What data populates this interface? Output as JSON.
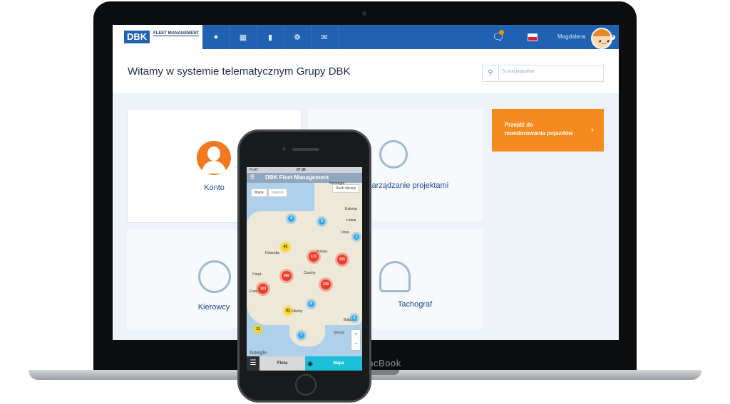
{
  "app": {
    "logo_text": "DBK",
    "logo_sub": "FLEET MANAGEMENT",
    "user_name": "Magdalena",
    "page_title": "Witamy w systemie telematycznym Grupy DBK",
    "search_placeholder": "Szukaj pojazdów",
    "nav_icons": [
      "globe-icon",
      "calendar-icon",
      "chart-icon",
      "gear-icon",
      "mail-icon"
    ],
    "accent_color": "#2061b1",
    "cta_color": "#f58b1f"
  },
  "tiles": {
    "konto": "Konto",
    "projects": "Zarządzanie projektami",
    "drivers": "Kierowcy",
    "tachograph": "Tachograf"
  },
  "cta": {
    "line1": "Przejdź do",
    "line2": "monitorowania pojazdów"
  },
  "laptop_brand": "MacBook",
  "phone": {
    "carrier": "PLAY",
    "time": "07:36",
    "title": "DBK Fleet Management",
    "map_toggle": [
      "Mapa",
      "Satelita"
    ],
    "traffic_button": "Ruch uliczny",
    "countries": [
      "Norwegia",
      "Estonia",
      "Łotwa",
      "Litwa",
      "Polska",
      "Holandia",
      "Czechy",
      "Francja",
      "Włochy",
      "Bułgaria",
      "Grecja",
      "Paryż"
    ],
    "clusters": [
      "4",
      "3",
      "41",
      "171",
      "235",
      "660",
      "3",
      "323",
      "230",
      "8",
      "51",
      "11",
      "7",
      "2"
    ],
    "zoom_in": "+",
    "zoom_out": "−",
    "map_provider": "Google",
    "tab_fleet": "Flota",
    "tab_map": "Mapa"
  }
}
